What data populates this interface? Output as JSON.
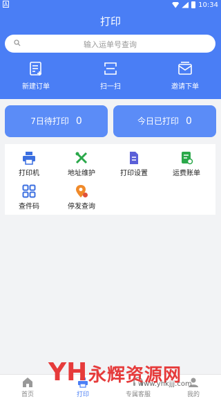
{
  "status_bar": {
    "time": "10:34",
    "left_badge": "A"
  },
  "header": {
    "title": "打印",
    "search": {
      "placeholder": "输入运单号查询"
    },
    "actions": [
      {
        "label": "新建订单",
        "icon": "new-order-icon"
      },
      {
        "label": "扫一扫",
        "icon": "scan-icon"
      },
      {
        "label": "邀请下单",
        "icon": "invite-order-icon"
      }
    ]
  },
  "stats": [
    {
      "label": "7日待打印",
      "value": "0"
    },
    {
      "label": "今日已打印",
      "value": "0"
    }
  ],
  "grid": {
    "items": [
      {
        "label": "打印机",
        "icon": "printer-icon",
        "color": "#3b6fe0"
      },
      {
        "label": "地址维护",
        "icon": "tools-icon",
        "color": "#2aa84a"
      },
      {
        "label": "打印设置",
        "icon": "document-icon",
        "color": "#5a5fd8"
      },
      {
        "label": "运费账单",
        "icon": "bill-icon",
        "color": "#2aa84a"
      },
      {
        "label": "查件码",
        "icon": "qrcode-icon",
        "color": "#3b6fe0"
      },
      {
        "label": "停发查询",
        "icon": "location-pin-icon",
        "color": "#f08a2a"
      }
    ]
  },
  "tabbar": {
    "tabs": [
      {
        "label": "首页",
        "icon": "home-icon",
        "active": false
      },
      {
        "label": "打印",
        "icon": "print-tab-icon",
        "active": true
      },
      {
        "label": "专属客服",
        "icon": "service-icon",
        "active": false
      },
      {
        "label": "我的",
        "icon": "profile-icon",
        "active": false
      }
    ]
  },
  "watermark": {
    "logo": "YH",
    "text": "永辉资源网",
    "url": "www.yhkjjj.com"
  },
  "colors": {
    "primary": "#4a7ef5",
    "stat_card": "#5b8cf7",
    "background": "#f2f3f5"
  }
}
